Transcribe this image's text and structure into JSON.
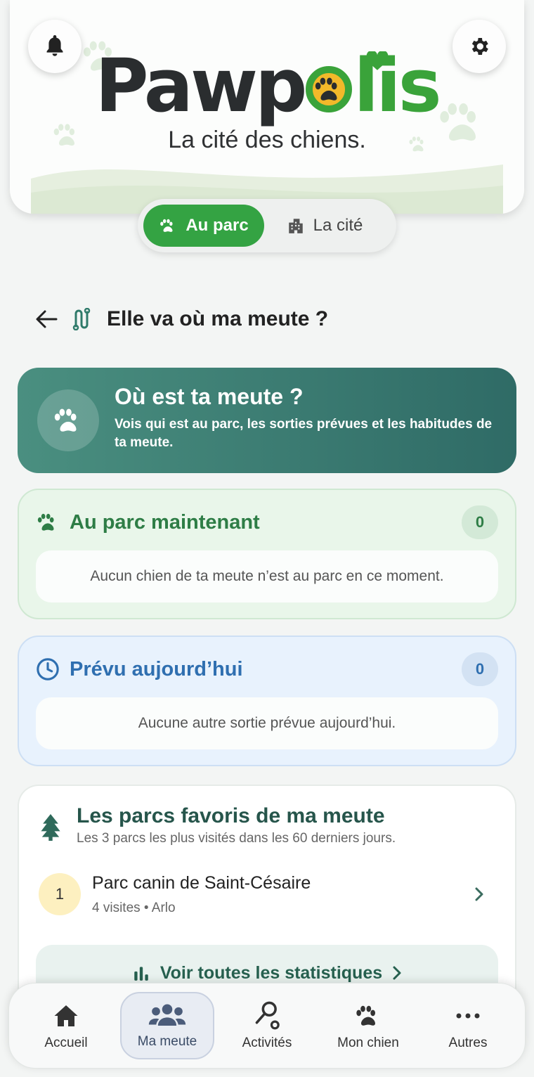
{
  "header": {
    "logo": {
      "part1": "Pawp",
      "part2": "lis"
    },
    "tagline": "La cité des chiens."
  },
  "segment": {
    "active_label": "Au parc",
    "inactive_label": "La cité"
  },
  "page": {
    "title": "Elle va où ma meute ?"
  },
  "hero": {
    "title": "Où est ta meute ?",
    "subtitle": "Vois qui est au parc, les sorties prévues et les habitudes de ta meute."
  },
  "park_now": {
    "title": "Au parc maintenant",
    "count": "0",
    "empty": "Aucun chien de ta meute n’est au parc en ce moment."
  },
  "planned": {
    "title": "Prévu aujourd’hui",
    "count": "0",
    "empty": "Aucune autre sortie prévue aujourd’hui."
  },
  "favorites": {
    "title": "Les parcs favoris de ma meute",
    "subtitle": "Les 3 parcs les plus visités dans les 60 derniers jours.",
    "items": [
      {
        "rank": "1",
        "name": "Parc canin de Saint-Césaire",
        "meta": "4 visites • Arlo"
      }
    ],
    "stats_label": "Voir toutes les statistiques"
  },
  "nav": {
    "items": [
      {
        "label": "Accueil",
        "icon": "home-icon"
      },
      {
        "label": "Ma meute",
        "icon": "group-icon"
      },
      {
        "label": "Activités",
        "icon": "route-icon"
      },
      {
        "label": "Mon chien",
        "icon": "paw-icon"
      },
      {
        "label": "Autres",
        "icon": "more-icon"
      }
    ],
    "active": "Ma meute"
  },
  "colors": {
    "brand_green": "#34a343",
    "logo_yellow": "#f2b92a",
    "hero_teal": "#2f6b66",
    "park_green": "#2e7d46",
    "plan_blue": "#2f6fb0"
  }
}
